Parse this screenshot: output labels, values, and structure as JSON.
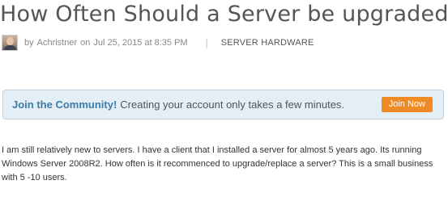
{
  "question": {
    "title": "How Often Should a Server be upgraded?",
    "meta": {
      "by": "by",
      "author": "Achristner",
      "on": "on",
      "date": "Jul 25, 2015 at 8:35 PM",
      "separator": "|",
      "category": "SERVER HARDWARE"
    },
    "body": "I am still relatively new to servers. I have a client that I installed a server for almost 5 years ago. Its running Windows Server 2008R2.   How often is it recommenced to upgrade/replace a server?  This is a small business with 5 -10 users."
  },
  "community_banner": {
    "strong": "Join the Community!",
    "text": "Creating your account only takes a few minutes.",
    "button_label": "Join Now",
    "accent_color": "#f08a24",
    "background_color": "#e4eef6",
    "link_color": "#3b7ca8"
  }
}
